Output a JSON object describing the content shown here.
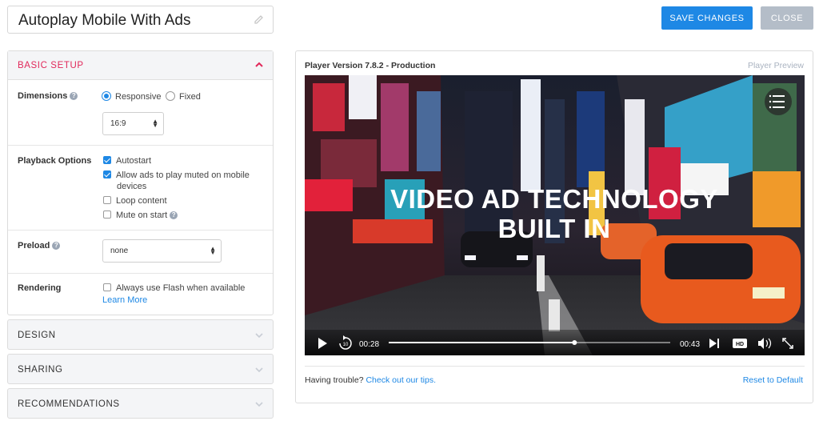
{
  "header": {
    "title": "Autoplay Mobile With Ads",
    "save_label": "SAVE CHANGES",
    "close_label": "CLOSE"
  },
  "basic_setup": {
    "title": "BASIC SETUP",
    "dimensions": {
      "label": "Dimensions",
      "options": [
        "Responsive",
        "Fixed"
      ],
      "selected": "Responsive",
      "ratio_value": "16:9"
    },
    "playback": {
      "label": "Playback Options",
      "checks": [
        {
          "label": "Autostart",
          "checked": true
        },
        {
          "label": "Allow ads to play muted on mobile",
          "label2": "devices",
          "checked": true
        },
        {
          "label": "Loop content",
          "checked": false
        },
        {
          "label": "Mute on start",
          "checked": false
        }
      ]
    },
    "preload": {
      "label": "Preload",
      "value": "none"
    },
    "rendering": {
      "label": "Rendering",
      "check_label": "Always use Flash when available",
      "checked": false,
      "link": "Learn More"
    }
  },
  "sections": [
    "DESIGN",
    "SHARING",
    "RECOMMENDATIONS"
  ],
  "preview": {
    "version": "Player Version 7.8.2 - Production",
    "label": "Player Preview",
    "video": {
      "overlay_line1": "VIDEO AD TECHNOLOGY",
      "overlay_line2": "BUILT IN",
      "current_time": "00:28",
      "duration": "00:43",
      "progress": 0.66,
      "hd_label": "HD"
    },
    "footer": {
      "trouble_text": "Having trouble?",
      "tips_link": "Check out our tips.",
      "reset_link": "Reset to Default"
    }
  },
  "colors": {
    "accent": "#1e88e5",
    "section_title": "#e1285a",
    "close_button": "#b4bdc8"
  }
}
